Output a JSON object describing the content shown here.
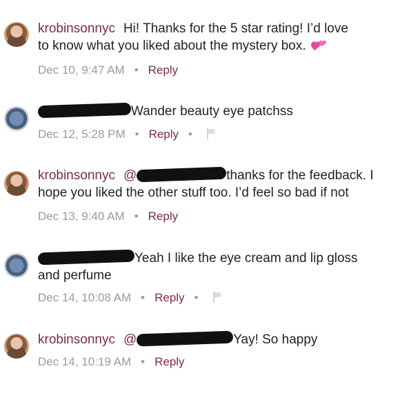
{
  "comments": [
    {
      "username": "krobinsonnyc",
      "text_line1": "Hi! Thanks for the 5 star rating! I’d love",
      "text_line2": "to know what you liked about the mystery box.",
      "time": "Dec 10, 9:47 AM",
      "reply": "Reply"
    },
    {
      "text_line1": "Wander beauty eye patchss",
      "time": "Dec 12, 5:28 PM",
      "reply": "Reply"
    },
    {
      "username": "krobinsonnyc",
      "mention_prefix": "@",
      "text_line1": "thanks for the feedback. I",
      "text_line2": "hope you liked the other stuff too. I’d feel so bad if not",
      "time": "Dec 13, 9:40 AM",
      "reply": "Reply"
    },
    {
      "text_line1": "Yeah I like the eye cream and lip gloss",
      "text_line2": "and perfume",
      "time": "Dec 14, 10:08 AM",
      "reply": "Reply"
    },
    {
      "username": "krobinsonnyc",
      "mention_prefix": "@",
      "text_line1": "Yay! So happy",
      "time": "Dec 14, 10:19 AM",
      "reply": "Reply"
    }
  ],
  "separator": "•",
  "colors": {
    "accent": "#7a2d3d",
    "meta": "#9a9a9a",
    "text": "#222222"
  },
  "icons": {
    "heart": "two-hearts-icon",
    "flag": "flag-icon"
  }
}
